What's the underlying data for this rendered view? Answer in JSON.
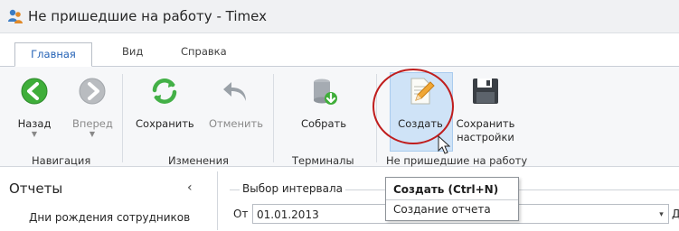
{
  "window": {
    "title": "Не пришедшие на работу - Timex",
    "app_icon": "people-icon"
  },
  "tabs": [
    {
      "label": "Главная",
      "active": true
    },
    {
      "label": "Вид",
      "active": false
    },
    {
      "label": "Справка",
      "active": false
    }
  ],
  "ribbon": {
    "groups": {
      "navigation": "Навигация",
      "changes": "Изменения",
      "terminals": "Терминалы",
      "absent": "Не пришедшие на работу"
    },
    "buttons": {
      "back": "Назад",
      "forward": "Вперед",
      "save": "Сохранить",
      "cancel": "Отменить",
      "collect": "Собрать",
      "create": "Создать",
      "save_settings_1": "Сохранить",
      "save_settings_2": "настройки"
    },
    "colors": {
      "accent": "#2563b6",
      "back_green": "#3fae3a",
      "refresh_green": "#43b047",
      "highlight": "#cfe3f7",
      "annotation_red": "#c01d1d"
    }
  },
  "reports_panel": {
    "title": "Отчеты",
    "collapse_glyph": "‹",
    "items": [
      "Дни рождения сотрудников"
    ]
  },
  "interval": {
    "legend": "Выбор интервала",
    "from_label": "От",
    "from_value": "01.01.2013",
    "dropdown_glyph": "▾",
    "trailing_text": "Д"
  },
  "tooltip": {
    "title": "Создать (Ctrl+N)",
    "description": "Создание отчета"
  }
}
